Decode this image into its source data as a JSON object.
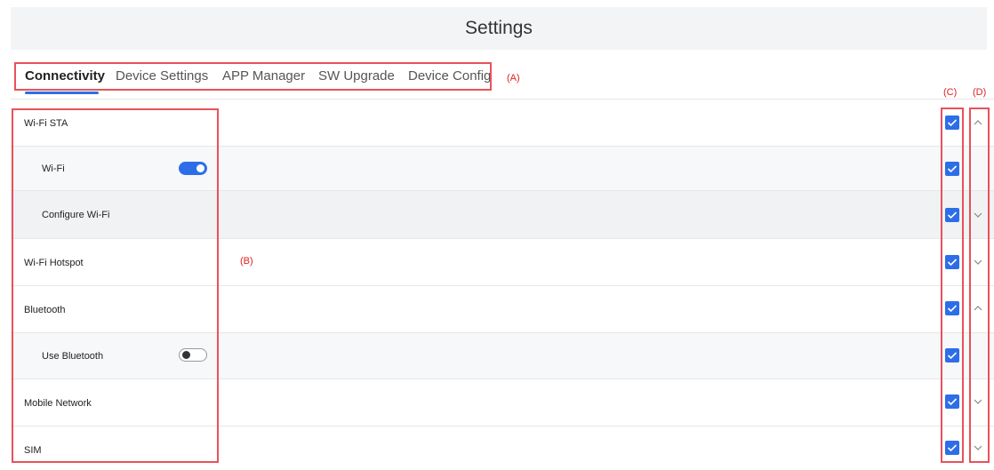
{
  "header": {
    "title": "Settings"
  },
  "tabs": [
    {
      "label": "Connectivity",
      "active": true
    },
    {
      "label": "Device Settings",
      "active": false
    },
    {
      "label": "APP Manager",
      "active": false
    },
    {
      "label": "SW Upgrade",
      "active": false
    },
    {
      "label": "Device Config",
      "active": false
    }
  ],
  "annotations": {
    "a": "(A)",
    "b": "(B)",
    "c": "(C)",
    "d": "(D)"
  },
  "rows": [
    {
      "label": "Wi-Fi STA",
      "checked": true,
      "expander": "chevron-up"
    },
    {
      "label": "Wi-Fi",
      "toggle": "on",
      "checked": true
    },
    {
      "label": "Configure Wi-Fi",
      "checked": true,
      "expander": "chevron-down"
    },
    {
      "label": "Wi-Fi Hotspot",
      "checked": true,
      "expander": "chevron-down"
    },
    {
      "label": "Bluetooth",
      "checked": true,
      "expander": "chevron-up"
    },
    {
      "label": "Use Bluetooth",
      "toggle": "off",
      "checked": true
    },
    {
      "label": "Mobile Network",
      "checked": true,
      "expander": "chevron-down"
    },
    {
      "label": "SIM",
      "checked": true,
      "expander": "chevron-down"
    }
  ],
  "colors": {
    "accent": "#2d6ee8",
    "annotation": "#e02020"
  }
}
